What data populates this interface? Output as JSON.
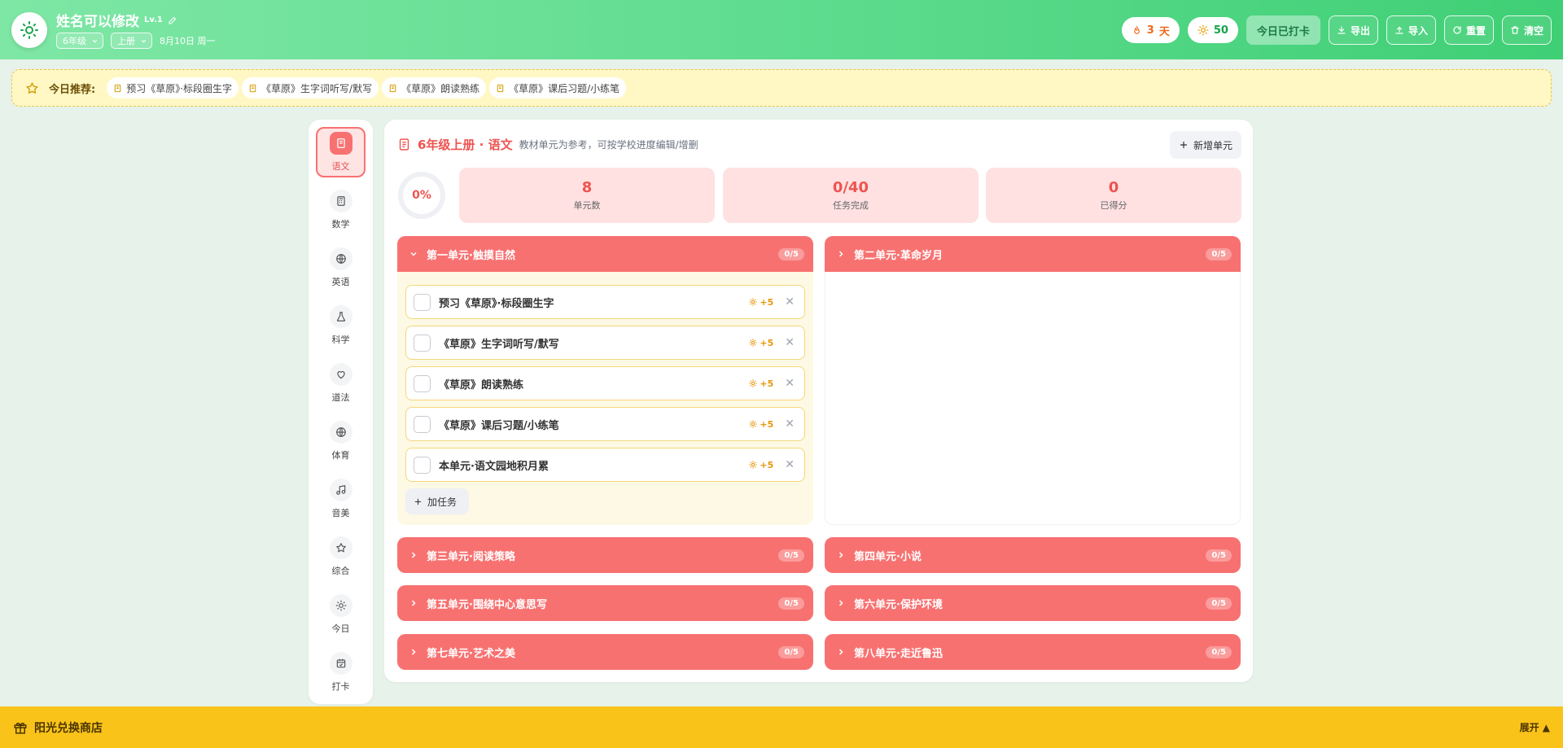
{
  "header": {
    "title": "姓名可以修改",
    "level": "Lv.1",
    "grade_select": "6年级",
    "term_select": "上册",
    "date": "8月10日 周一",
    "streak_value": "3",
    "streak_unit": "天",
    "sun_points": "50",
    "checked_in_label": "今日已打卡",
    "export_label": "导出",
    "import_label": "导入",
    "reset_label": "重置",
    "clear_label": "清空"
  },
  "recommend": {
    "label": "今日推荐:",
    "items": [
      "预习《草原》·标段圈生字",
      "《草原》生字词听写/默写",
      "《草原》朗读熟练",
      "《草原》课后习题/小练笔"
    ]
  },
  "sidebar": {
    "items": [
      {
        "label": "语文",
        "icon": "book-icon"
      },
      {
        "label": "数学",
        "icon": "calculator-icon"
      },
      {
        "label": "英语",
        "icon": "globe-icon"
      },
      {
        "label": "科学",
        "icon": "flask-icon"
      },
      {
        "label": "道法",
        "icon": "heart-icon"
      },
      {
        "label": "体育",
        "icon": "globe-icon"
      },
      {
        "label": "音美",
        "icon": "music-icon"
      },
      {
        "label": "综合",
        "icon": "star-icon"
      },
      {
        "label": "今日",
        "icon": "sun-icon"
      },
      {
        "label": "打卡",
        "icon": "calendar-check-icon"
      }
    ]
  },
  "panel": {
    "title": "6年级上册 · 语文",
    "description": "教材单元为参考，可按学校进度编辑/增删",
    "add_unit_label": "新增单元",
    "progress_text": "0%",
    "progress_value": 0,
    "stats": [
      {
        "value": "8",
        "label": "单元数"
      },
      {
        "value": "0/40",
        "label": "任务完成"
      },
      {
        "value": "0",
        "label": "已得分"
      }
    ]
  },
  "units": [
    {
      "name": "第一单元·触摸自然",
      "progress": "0/5",
      "expanded": true
    },
    {
      "name": "第二单元·革命岁月",
      "progress": "0/5",
      "expanded": false
    },
    {
      "name": "第三单元·阅读策略",
      "progress": "0/5",
      "expanded": false
    },
    {
      "name": "第四单元·小说",
      "progress": "0/5",
      "expanded": false
    },
    {
      "name": "第五单元·围绕中心意思写",
      "progress": "0/5",
      "expanded": false
    },
    {
      "name": "第六单元·保护环境",
      "progress": "0/5",
      "expanded": false
    },
    {
      "name": "第七单元·艺术之美",
      "progress": "0/5",
      "expanded": false
    },
    {
      "name": "第八单元·走近鲁迅",
      "progress": "0/5",
      "expanded": false
    }
  ],
  "tasks": [
    {
      "name": "预习《草原》·标段圈生字",
      "points": "+5"
    },
    {
      "name": "《草原》生字词听写/默写",
      "points": "+5"
    },
    {
      "name": "《草原》朗读熟练",
      "points": "+5"
    },
    {
      "name": "《草原》课后习题/小练笔",
      "points": "+5"
    },
    {
      "name": "本单元·语文园地积月累",
      "points": "+5"
    }
  ],
  "add_task_label": "加任务",
  "footer": {
    "shop_label": "阳光兑换商店",
    "expand_label": "展开 ▲"
  },
  "colors": {
    "header_green": "#4ad47f",
    "unit_red": "#f87171",
    "accent_red": "#ef5350",
    "stat_bg": "#ffe1e1",
    "recommend_bg": "#fff8c5",
    "footer_yellow": "#fac31a"
  }
}
